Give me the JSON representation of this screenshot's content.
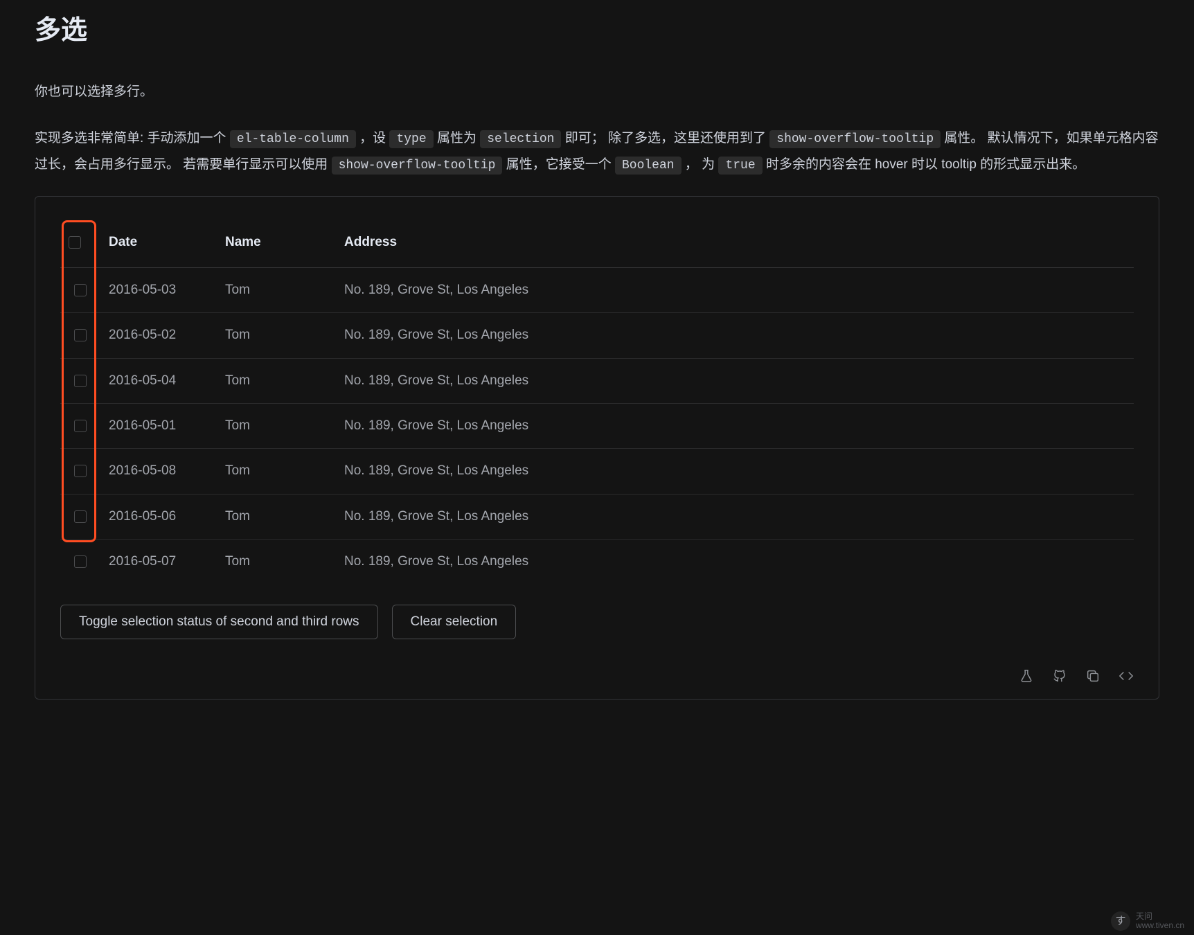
{
  "heading": "多选",
  "intro": "你也可以选择多行。",
  "desc": {
    "p1a": "实现多选非常简单: 手动添加一个 ",
    "c1": "el-table-column",
    "p1b": " ，设 ",
    "c2": "type",
    "p1c": " 属性为 ",
    "c3": "selection",
    "p1d": " 即可； 除了多选，这里还使用到了 ",
    "c4": "show-overflow-tooltip",
    "p1e": " 属性。 默认情况下，如果单元格内容过长，会占用多行显示。 若需要单行显示可以使用 ",
    "c5": "show-overflow-tooltip",
    "p1f": " 属性，它接受一个 ",
    "c6": "Boolean",
    "p1g": " ， 为 ",
    "c7": "true",
    "p1h": " 时多余的内容会在 hover 时以 tooltip 的形式显示出来。"
  },
  "table": {
    "headers": {
      "date": "Date",
      "name": "Name",
      "address": "Address"
    },
    "rows": [
      {
        "date": "2016-05-03",
        "name": "Tom",
        "address": "No. 189, Grove St, Los Angeles"
      },
      {
        "date": "2016-05-02",
        "name": "Tom",
        "address": "No. 189, Grove St, Los Angeles"
      },
      {
        "date": "2016-05-04",
        "name": "Tom",
        "address": "No. 189, Grove St, Los Angeles"
      },
      {
        "date": "2016-05-01",
        "name": "Tom",
        "address": "No. 189, Grove St, Los Angeles"
      },
      {
        "date": "2016-05-08",
        "name": "Tom",
        "address": "No. 189, Grove St, Los Angeles"
      },
      {
        "date": "2016-05-06",
        "name": "Tom",
        "address": "No. 189, Grove St, Los Angeles"
      },
      {
        "date": "2016-05-07",
        "name": "Tom",
        "address": "No. 189, Grove St, Los Angeles"
      }
    ]
  },
  "buttons": {
    "toggle": "Toggle selection status of second and third rows",
    "clear": "Clear selection"
  },
  "watermark": {
    "brand": "天问",
    "url": "www.tiven.cn"
  }
}
